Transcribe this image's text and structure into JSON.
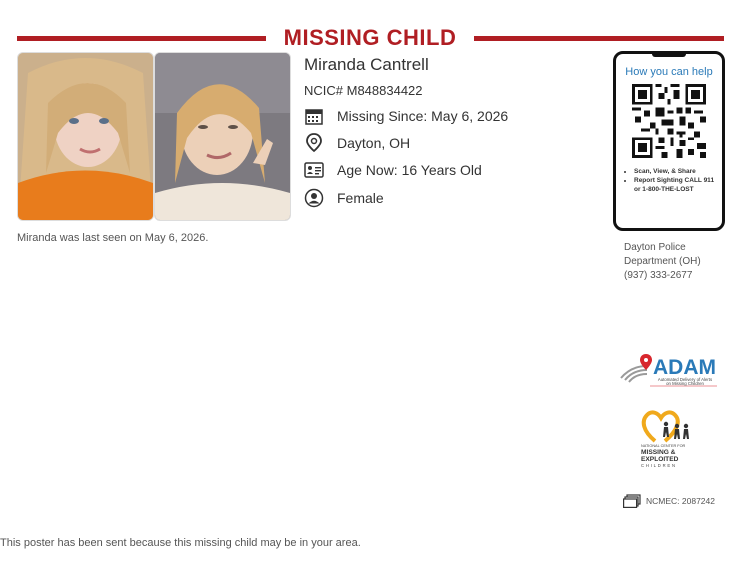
{
  "header": {
    "title": "MISSING CHILD"
  },
  "child": {
    "name": "Miranda Cantrell",
    "ncic": "NCIC# M848834422",
    "missing_since": "Missing Since: May 6, 2026",
    "location": "Dayton, OH",
    "age_now": "Age Now: 16 Years Old",
    "sex": "Female"
  },
  "caption": "Miranda was last seen on May 6, 2026.",
  "phone": {
    "help_title": "How you can help",
    "bullets": [
      "Scan, View, & Share",
      "Report Sighting CALL 911 or 1-800-THE-LOST"
    ]
  },
  "agency": {
    "line1": "Dayton Police",
    "line2": "Department (OH)",
    "phone": "(937) 333-2677"
  },
  "logos": {
    "adam_name": "ADAM",
    "adam_tagline_1": "Automated Delivery of Alerts",
    "adam_tagline_2": "on Missing Children",
    "ncmec_small": "NATIONAL CENTER FOR",
    "ncmec_line1": "MISSING &",
    "ncmec_line2": "EXPLOITED",
    "ncmec_line3": "CHILDREN"
  },
  "ncmec_id": "NCMEC: 2087242",
  "footer": "This poster has been sent because this missing child may be in your area.",
  "colors": {
    "brand_red": "#b01e23",
    "link_blue": "#2a7ab8",
    "adam_blue": "#2a7ab8"
  },
  "icons": [
    "calendar-icon",
    "location-pin-icon",
    "id-card-icon",
    "person-icon",
    "qr-code-icon",
    "documents-icon"
  ]
}
